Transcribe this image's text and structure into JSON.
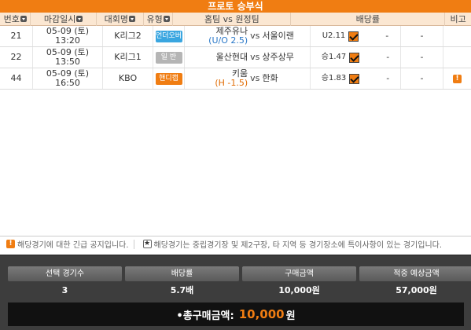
{
  "title": "프로토 승부식",
  "columns": [
    "번호",
    "마감일시",
    "대회명",
    "유형",
    "홈팀 vs 원정팀",
    "배당률",
    "비고"
  ],
  "rows": [
    {
      "no": "21",
      "date": "05-09 (토)",
      "time": "13:20",
      "league": "K리그2",
      "type": "언더오버",
      "type_color": "#3aa6e0",
      "home": "제주유나",
      "home_sub": "(U/O 2.5)",
      "vs": "vs",
      "away": "서울이랜",
      "odds_label": "U2.11",
      "odds_mid": "-",
      "odds_right": "-",
      "note": ""
    },
    {
      "no": "22",
      "date": "05-09 (토)",
      "time": "13:50",
      "league": "K리그1",
      "type": "일 반",
      "type_color": "#b5b5b5",
      "home": "울산현대",
      "home_sub": "",
      "vs": "vs",
      "away": "상주상무",
      "odds_label": "승1.47",
      "odds_mid": "-",
      "odds_right": "-",
      "note": ""
    },
    {
      "no": "44",
      "date": "05-09 (토)",
      "time": "16:50",
      "league": "KBO",
      "type": "핸디캡",
      "type_color": "#f07d12",
      "home": "키움",
      "home_sub": "(H -1.5)",
      "vs": "vs",
      "away": "한화",
      "odds_label": "승1.83",
      "odds_mid": "-",
      "odds_right": "-",
      "note": "!"
    }
  ],
  "notice": {
    "left": "해당경기에 대한 긴급 공지입니다.",
    "right": "해당경기는 중립경기장 및 제2구장, 타 지역 등 경기장소에 특이사항이 있는 경기입니다."
  },
  "summary": {
    "headers": [
      "선택 경기수",
      "배당률",
      "구매금액",
      "적중 예상금액"
    ],
    "values": [
      "3",
      "5.7배",
      "10,000원",
      "57,000원"
    ],
    "total_label": "•총구매금액:",
    "total_amount": "10,000",
    "total_unit": "원"
  },
  "colors": {
    "accent": "#f07d12",
    "header_bg": "#fbe7d2",
    "summary_bg": "#3d3d3d"
  }
}
